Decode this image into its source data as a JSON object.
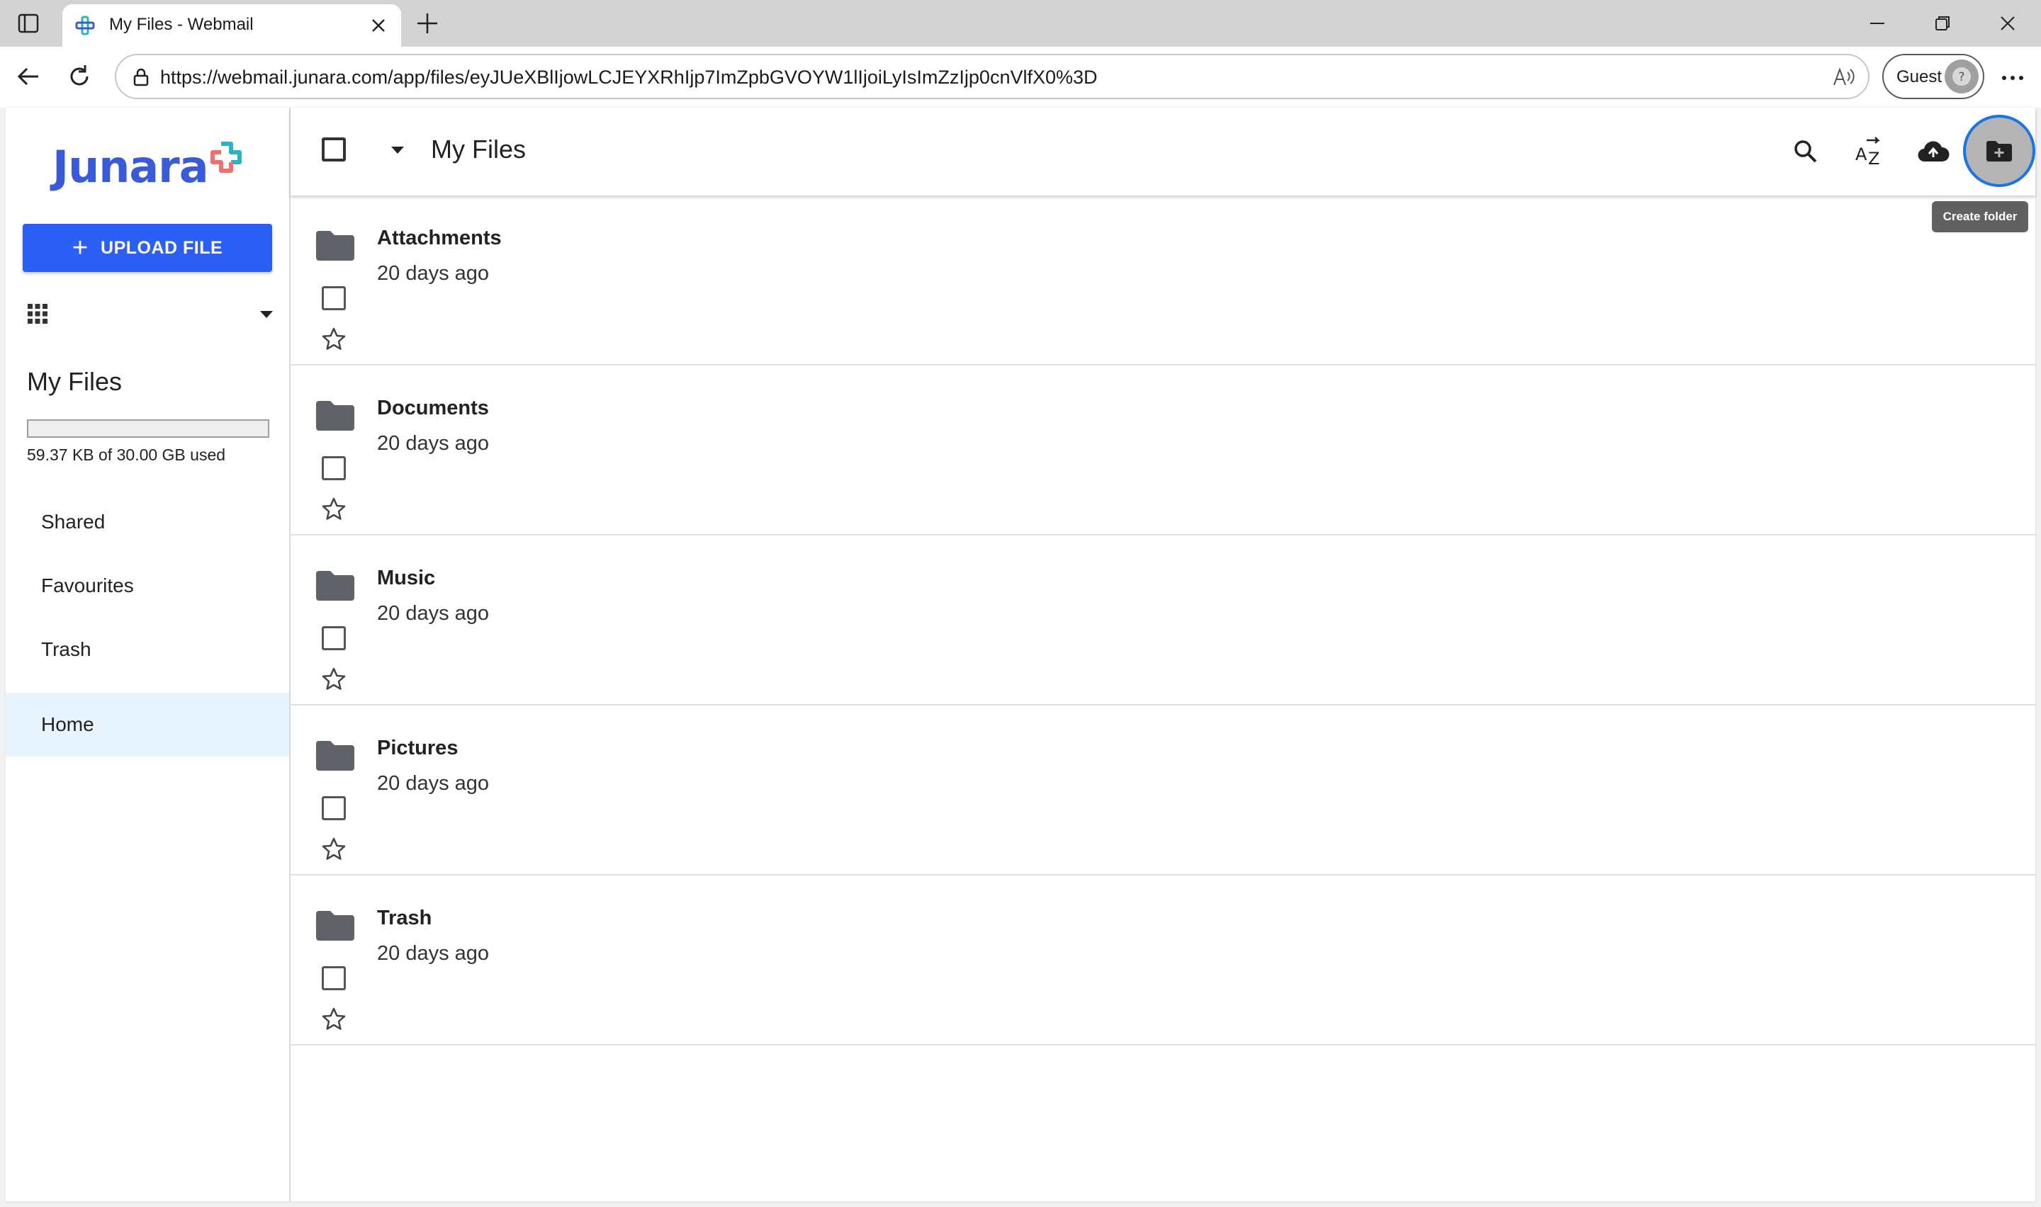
{
  "browser": {
    "tab_title": "My Files - Webmail",
    "url": "https://webmail.junara.com/app/files/eyJUeXBlIjowLCJEYXRhIjp7ImZpbGVOYW1lIjoiLyIsImZzIjp0cnVlfX0%3D",
    "profile_label": "Guest"
  },
  "sidebar": {
    "logo_text": "Junara",
    "upload_label": "UPLOAD FILE",
    "title": "My Files",
    "storage_text": "59.37 KB of 30.00 GB used",
    "storage_fraction": 2e-06,
    "items": [
      {
        "label": "Shared"
      },
      {
        "label": "Favourites"
      },
      {
        "label": "Trash"
      },
      {
        "label": "Home",
        "active": true
      }
    ]
  },
  "main": {
    "title": "My Files",
    "tooltip": "Create folder",
    "icons": [
      "search-icon",
      "sort-az-icon",
      "cloud-upload-icon",
      "create-folder-icon"
    ],
    "files": [
      {
        "name": "Attachments",
        "date": "20 days ago"
      },
      {
        "name": "Documents",
        "date": "20 days ago"
      },
      {
        "name": "Music",
        "date": "20 days ago"
      },
      {
        "name": "Pictures",
        "date": "20 days ago"
      },
      {
        "name": "Trash",
        "date": "20 days ago"
      }
    ]
  },
  "colors": {
    "accent": "#2c5ff6",
    "active_item_bg": "#e8f4fd",
    "focus_ring": "#1a73e8"
  }
}
